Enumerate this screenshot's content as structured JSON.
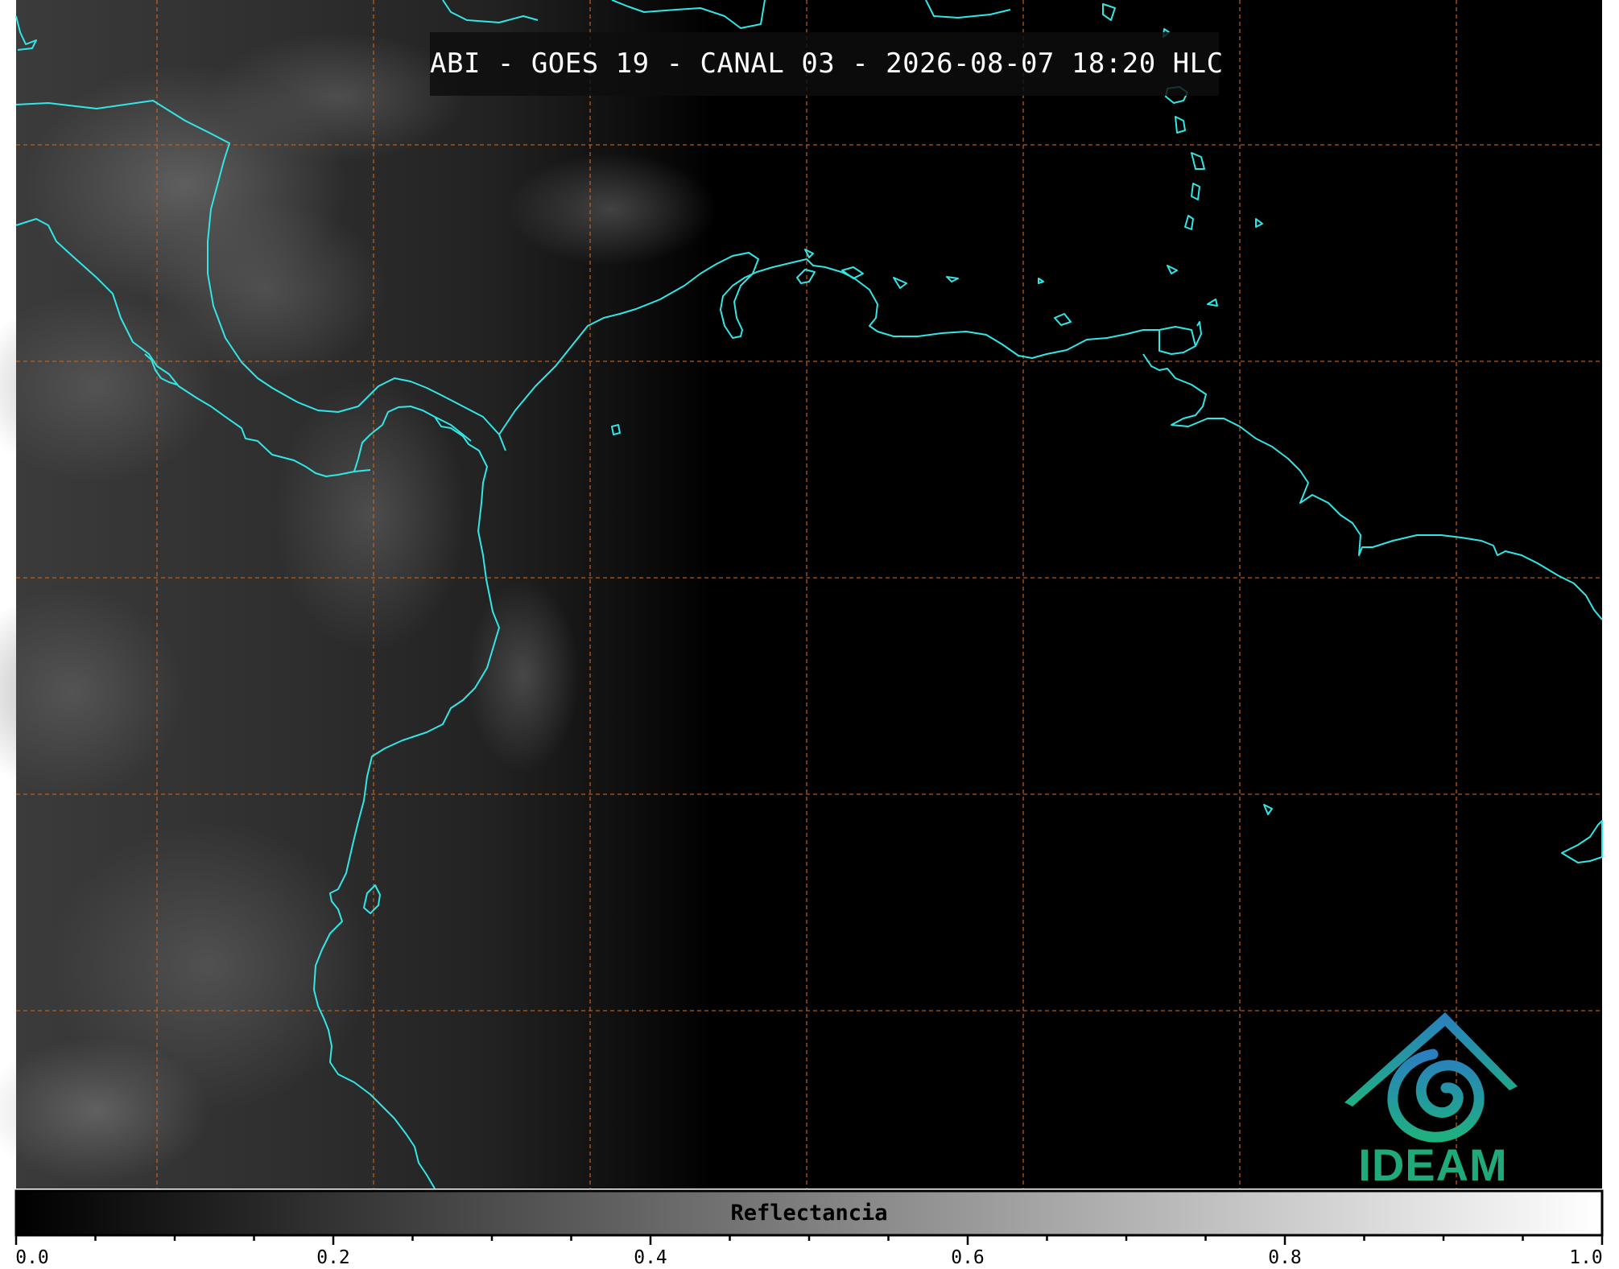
{
  "title": "ABI - GOES 19 - CANAL 03 - 2026-08-07 18:20 HLC",
  "logo": {
    "text": "IDEAM",
    "colors": [
      "#2aa0c0",
      "#1faa7a"
    ]
  },
  "colorbar": {
    "label": "Reflectancia",
    "min": 0.0,
    "max": 1.0,
    "tick_labels": [
      "0.0",
      "0.2",
      "0.4",
      "0.6",
      "0.8",
      "1.0"
    ],
    "colormap": "grayscale"
  },
  "colors": {
    "coastline": "#33e6e6",
    "gridlines": "#c8641e",
    "background": "#000000"
  }
}
